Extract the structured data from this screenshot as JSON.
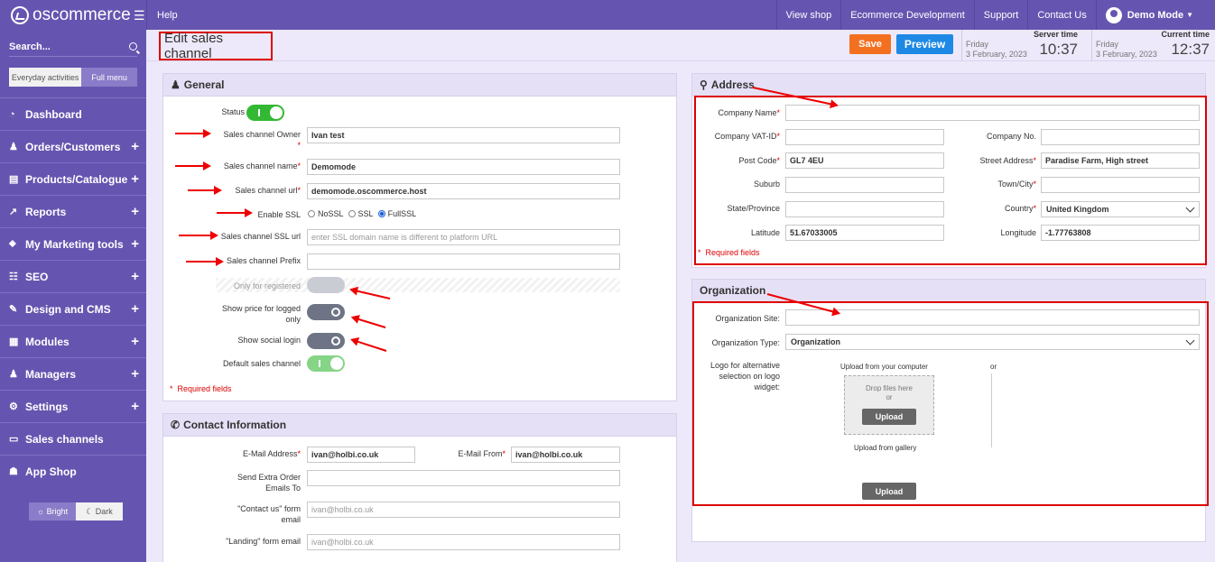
{
  "app": {
    "logo": "oscommerce"
  },
  "topbar": {
    "help": "Help",
    "right": [
      "View shop",
      "Ecommerce Development",
      "Support",
      "Contact Us"
    ],
    "user": "Demo Mode"
  },
  "sidebar": {
    "search": "Search...",
    "tabs": [
      "Everyday activities",
      "Full menu"
    ],
    "items": [
      {
        "label": "Dashboard",
        "icon": "dashboard-icon",
        "expand": false
      },
      {
        "label": "Orders/Customers",
        "icon": "users-icon",
        "expand": true
      },
      {
        "label": "Products/Catalogue",
        "icon": "folder-icon",
        "expand": true
      },
      {
        "label": "Reports",
        "icon": "chart-icon",
        "expand": true
      },
      {
        "label": "My Marketing tools",
        "icon": "tag-icon",
        "expand": true
      },
      {
        "label": "SEO",
        "icon": "sitemap-icon",
        "expand": true
      },
      {
        "label": "Design and CMS",
        "icon": "brush-icon",
        "expand": true
      },
      {
        "label": "Modules",
        "icon": "modules-icon",
        "expand": true
      },
      {
        "label": "Managers",
        "icon": "user-icon",
        "expand": true
      },
      {
        "label": "Settings",
        "icon": "cogs-icon",
        "expand": true
      },
      {
        "label": "Sales channels",
        "icon": "monitor-icon",
        "expand": false
      },
      {
        "label": "App Shop",
        "icon": "cart-icon",
        "expand": false
      }
    ],
    "theme": [
      "Bright",
      "Dark"
    ]
  },
  "header": {
    "title": "Edit sales channel",
    "save": "Save",
    "preview": "Preview",
    "server_time": {
      "label": "Server time",
      "day": "Friday",
      "date": "3 February, 2023",
      "time": "10:37"
    },
    "current_time": {
      "label": "Current time",
      "day": "Friday",
      "date": "3 February, 2023",
      "time": "12:37"
    }
  },
  "general": {
    "title": "General",
    "status_label": "Status",
    "owner_label": "Sales channel Owner",
    "owner_value": "Ivan test",
    "name_label": "Sales channel name",
    "name_value": "Demomode",
    "url_label": "Sales channel url",
    "url_value": "demomode.oscommerce.host",
    "ssl_label": "Enable SSL",
    "ssl_options": [
      "NoSSL",
      "SSL",
      "FullSSL"
    ],
    "ssl_url_label": "Sales channel SSL url",
    "ssl_url_placeholder": "enter SSL domain name is different to platform URL",
    "prefix_label": "Sales channel Prefix",
    "only_registered_label": "Only for registered",
    "show_price_label": "Show price for logged only",
    "show_social_label": "Show social login",
    "default_label": "Default sales channel",
    "required_note": "Required fields"
  },
  "contact": {
    "title": "Contact Information",
    "email_label": "E-Mail Address",
    "email_value": "ivan@holbi.co.uk",
    "email_from_label": "E-Mail From",
    "email_from_value": "ivan@holbi.co.uk",
    "extra_label": "Send Extra Order Emails To",
    "contact_form_label": "\"Contact us\" form email",
    "contact_form_placeholder": "ivan@holbi.co.uk",
    "landing_label": "\"Landing\" form email",
    "landing_placeholder": "ivan@holbi.co.uk"
  },
  "address": {
    "title": "Address",
    "company_label": "Company Name",
    "vat_label": "Company VAT-ID",
    "company_no_label": "Company No.",
    "postcode_label": "Post Code",
    "postcode_value": "GL7 4EU",
    "street_label": "Street Address",
    "street_value": "Paradise Farm, High street",
    "suburb_label": "Suburb",
    "town_label": "Town/City",
    "state_label": "State/Province",
    "country_label": "Country",
    "country_value": "United Kingdom",
    "lat_label": "Latitude",
    "lat_value": "51.67033005",
    "lng_label": "Longitude",
    "lng_value": "-1.77763808",
    "required_note": "Required fields"
  },
  "organization": {
    "title": "Organization",
    "site_label": "Organization Site:",
    "type_label": "Organization Type:",
    "type_value": "Organization",
    "logo_label": "Logo for alternative selection on logo widget:",
    "upload_computer": "Upload from your computer",
    "or": "or",
    "drop_text": "Drop files here",
    "drop_or": "or",
    "upload_btn": "Upload",
    "upload_gallery": "Upload from gallery",
    "upload_btn2": "Upload"
  },
  "colors": {
    "brand": "#6655b0",
    "save": "#f37021",
    "preview": "#1e88e5",
    "toggle_on": "#33b833",
    "annotation": "#dd0000"
  }
}
